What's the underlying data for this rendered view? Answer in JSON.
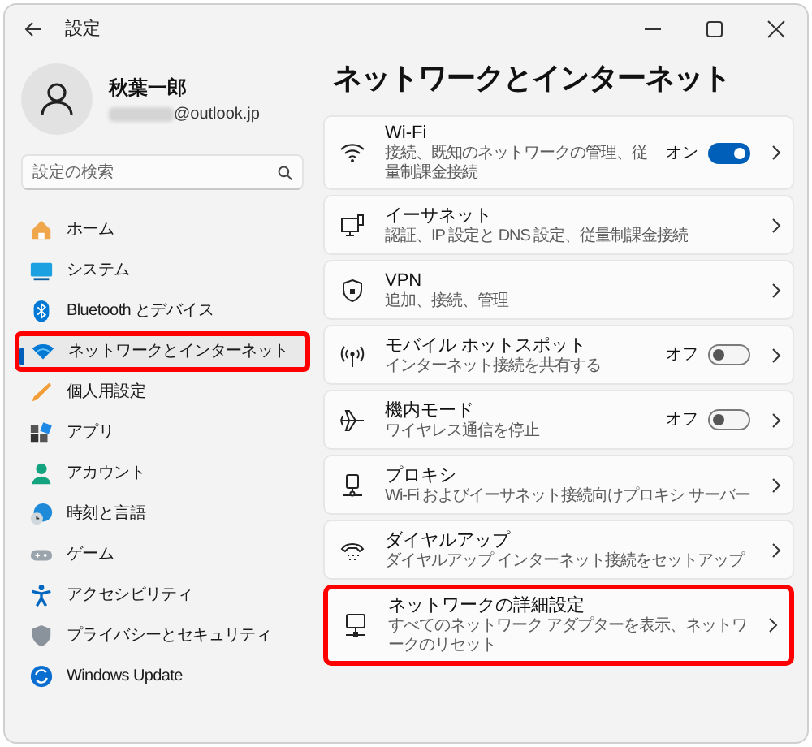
{
  "window": {
    "title": "設定"
  },
  "user": {
    "name": "秋葉一郎",
    "email": "@outlook.jp"
  },
  "search": {
    "placeholder": "設定の検索"
  },
  "sidebar": {
    "items": [
      {
        "label": "ホーム",
        "selected": false,
        "highlighted": false
      },
      {
        "label": "システム",
        "selected": false,
        "highlighted": false
      },
      {
        "label": "Bluetooth とデバイス",
        "selected": false,
        "highlighted": false
      },
      {
        "label": "ネットワークとインターネット",
        "selected": true,
        "highlighted": true
      },
      {
        "label": "個人用設定",
        "selected": false,
        "highlighted": false
      },
      {
        "label": "アプリ",
        "selected": false,
        "highlighted": false
      },
      {
        "label": "アカウント",
        "selected": false,
        "highlighted": false
      },
      {
        "label": "時刻と言語",
        "selected": false,
        "highlighted": false
      },
      {
        "label": "ゲーム",
        "selected": false,
        "highlighted": false
      },
      {
        "label": "アクセシビリティ",
        "selected": false,
        "highlighted": false
      },
      {
        "label": "プライバシーとセキュリティ",
        "selected": false,
        "highlighted": false
      },
      {
        "label": "Windows Update",
        "selected": false,
        "highlighted": false
      }
    ]
  },
  "page_title": "ネットワークとインターネット",
  "settings": [
    {
      "title": "Wi-Fi",
      "description": "接続、既知のネットワークの管理、従量制課金接続",
      "kind": "toggle",
      "toggle_label": "オン",
      "on": true,
      "highlighted": false
    },
    {
      "title": "イーサネット",
      "description": "認証、IP 設定と DNS 設定、従量制課金接続",
      "kind": "link",
      "highlighted": false
    },
    {
      "title": "VPN",
      "description": "追加、接続、管理",
      "kind": "link",
      "highlighted": false
    },
    {
      "title": "モバイル ホットスポット",
      "description": "インターネット接続を共有する",
      "kind": "toggle",
      "toggle_label": "オフ",
      "on": false,
      "highlighted": false
    },
    {
      "title": "機内モード",
      "description": "ワイヤレス通信を停止",
      "kind": "toggle",
      "toggle_label": "オフ",
      "on": false,
      "highlighted": false
    },
    {
      "title": "プロキシ",
      "description": "Wi-Fi およびイーサネット接続向けプロキシ サーバー",
      "kind": "link",
      "highlighted": false
    },
    {
      "title": "ダイヤルアップ",
      "description": "ダイヤルアップ インターネット接続をセットアップ",
      "kind": "link",
      "highlighted": false
    },
    {
      "title": "ネットワークの詳細設定",
      "description": "すべてのネットワーク アダプターを表示、ネットワークのリセット",
      "kind": "link",
      "highlighted": true
    }
  ]
}
